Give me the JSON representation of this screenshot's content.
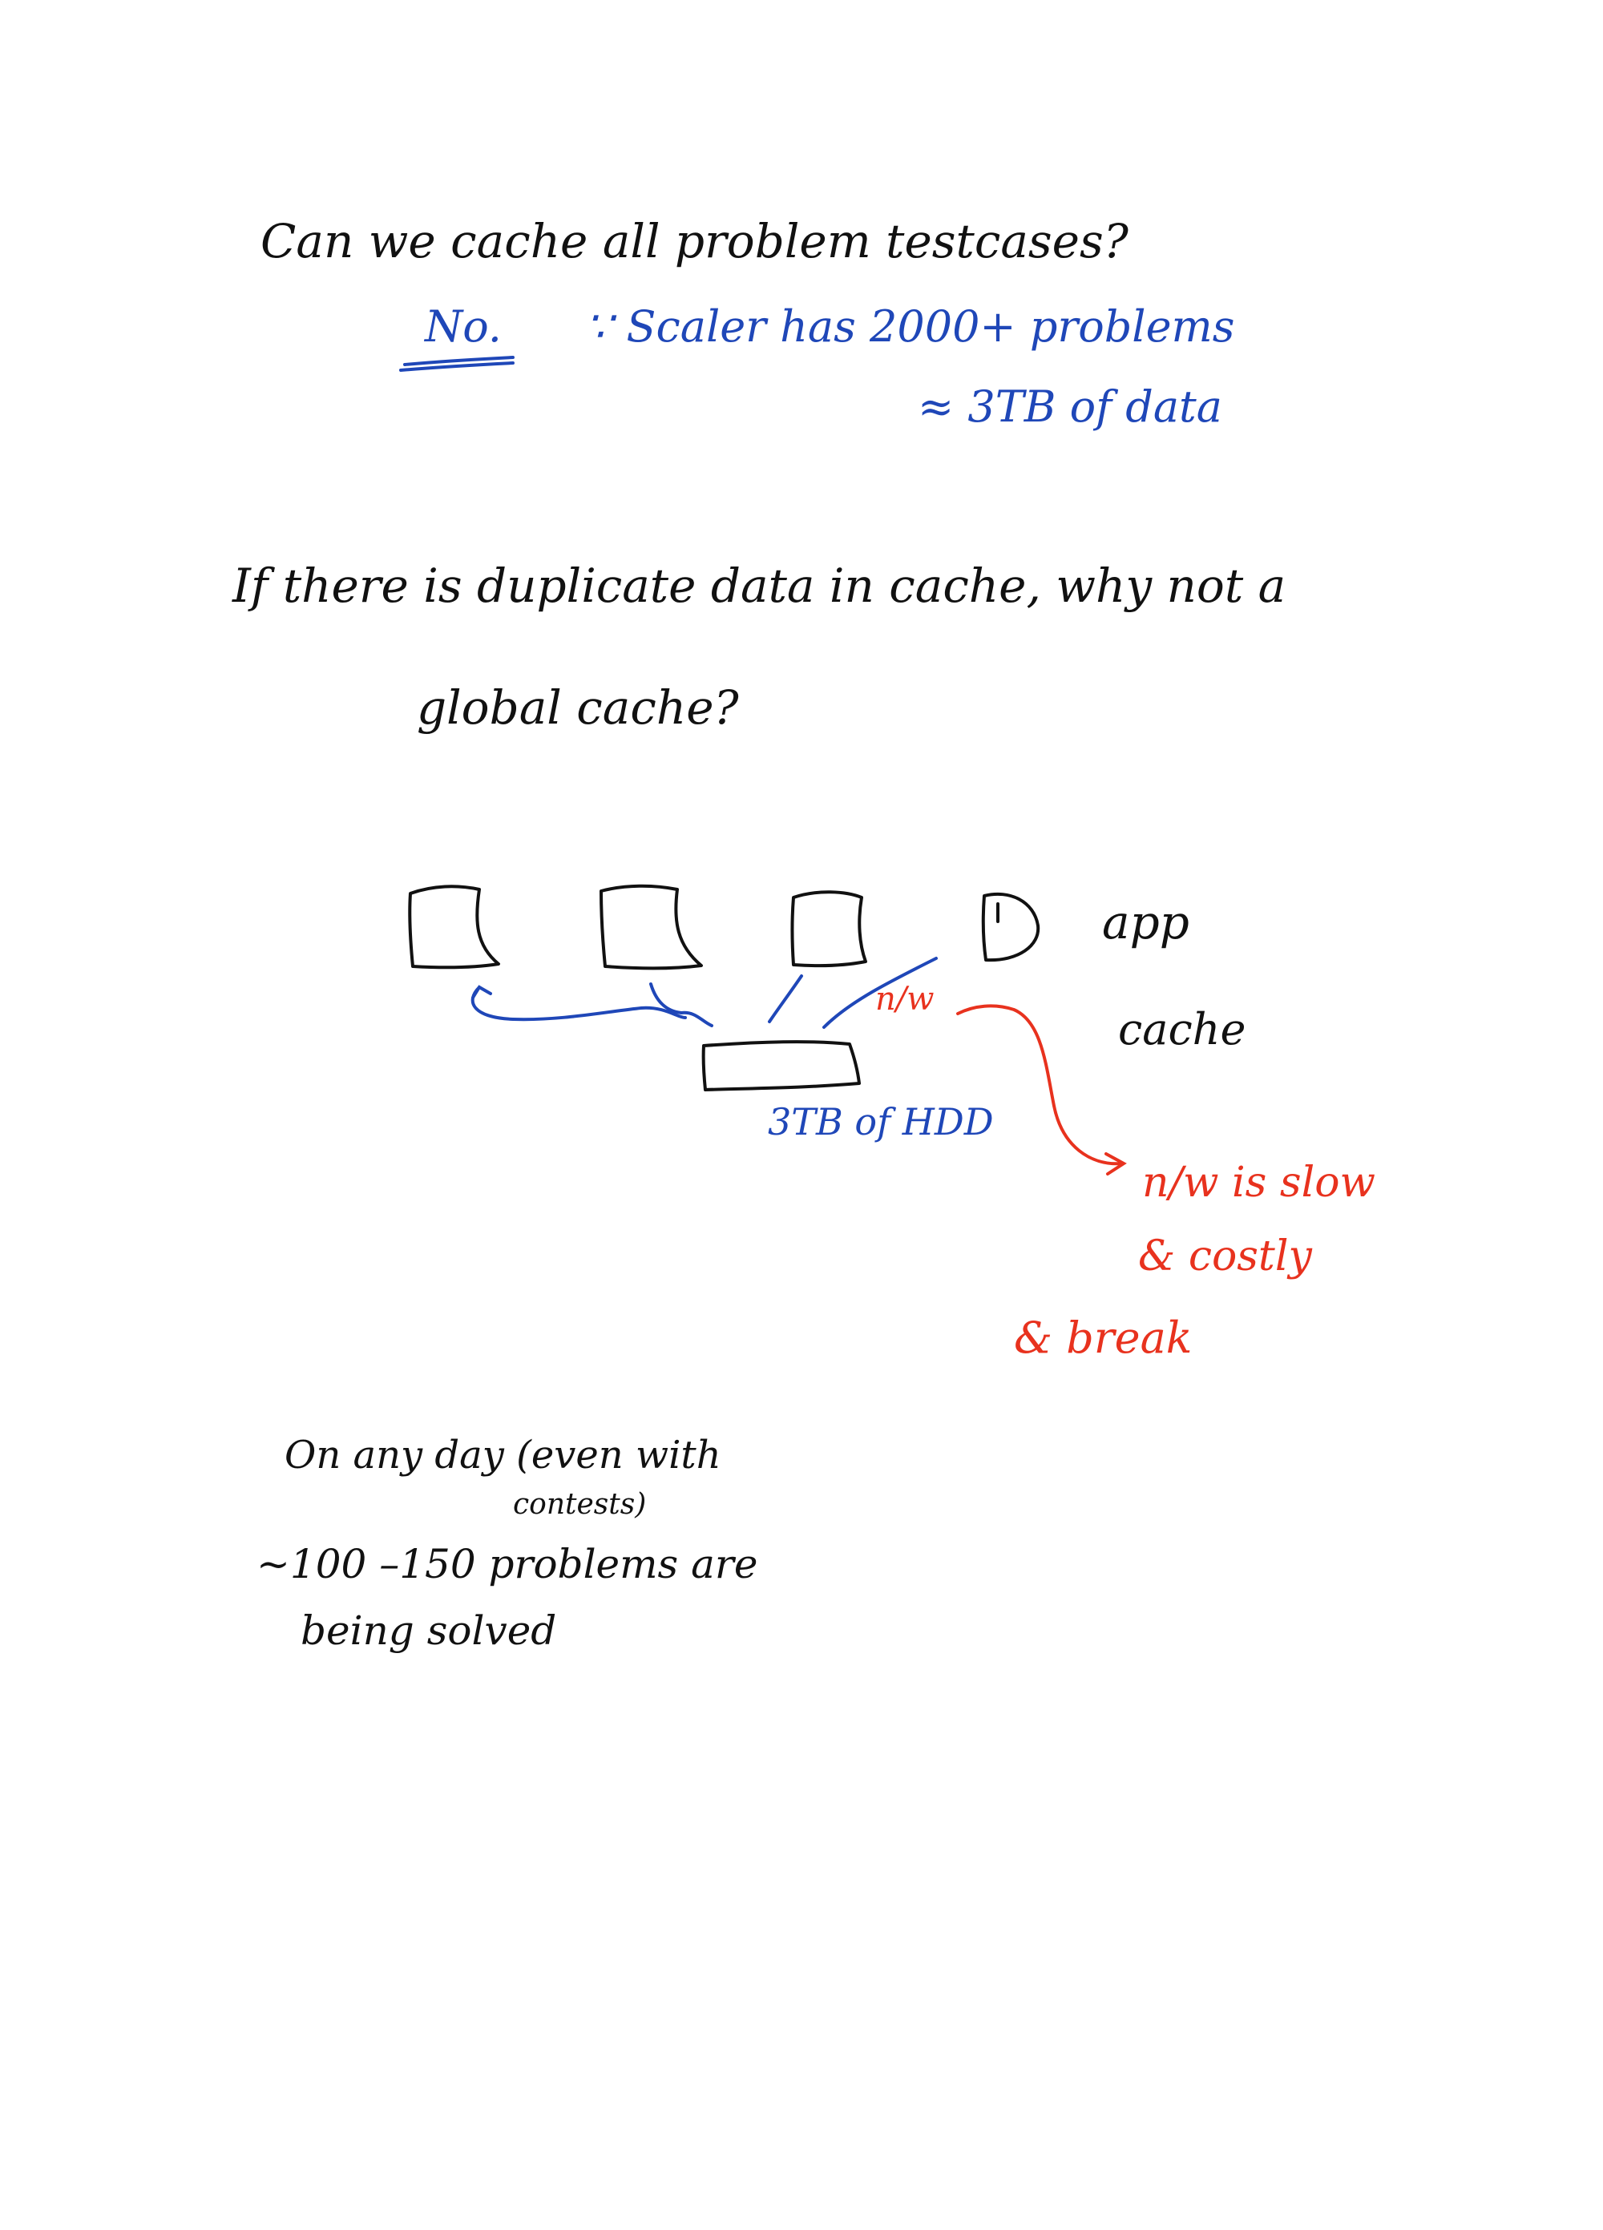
{
  "question_1": "Can we cache all problem testcases?",
  "answer_1": {
    "no": "No.",
    "reason": "∵ Scaler has 2000+ problems",
    "size": "≈ 3TB of data"
  },
  "question_2": {
    "line_1": "If there is duplicate data in cache, why not a",
    "line_2": "global cache?"
  },
  "diagram": {
    "app_label": "app",
    "cache_label": "cache",
    "network_label": "n/w",
    "storage_label": "3TB of HDD"
  },
  "network_notes": {
    "line_1": "n/w is slow",
    "line_2": "& costly",
    "line_3": "& break"
  },
  "bottom_note": {
    "line_1": "On any day (even with",
    "line_2": "contests)",
    "line_3": "~100 –150 problems are",
    "line_4": "being solved"
  },
  "colors": {
    "black_ink": "#111111",
    "blue_ink": "#1f47b8",
    "red_ink": "#e8321e"
  }
}
